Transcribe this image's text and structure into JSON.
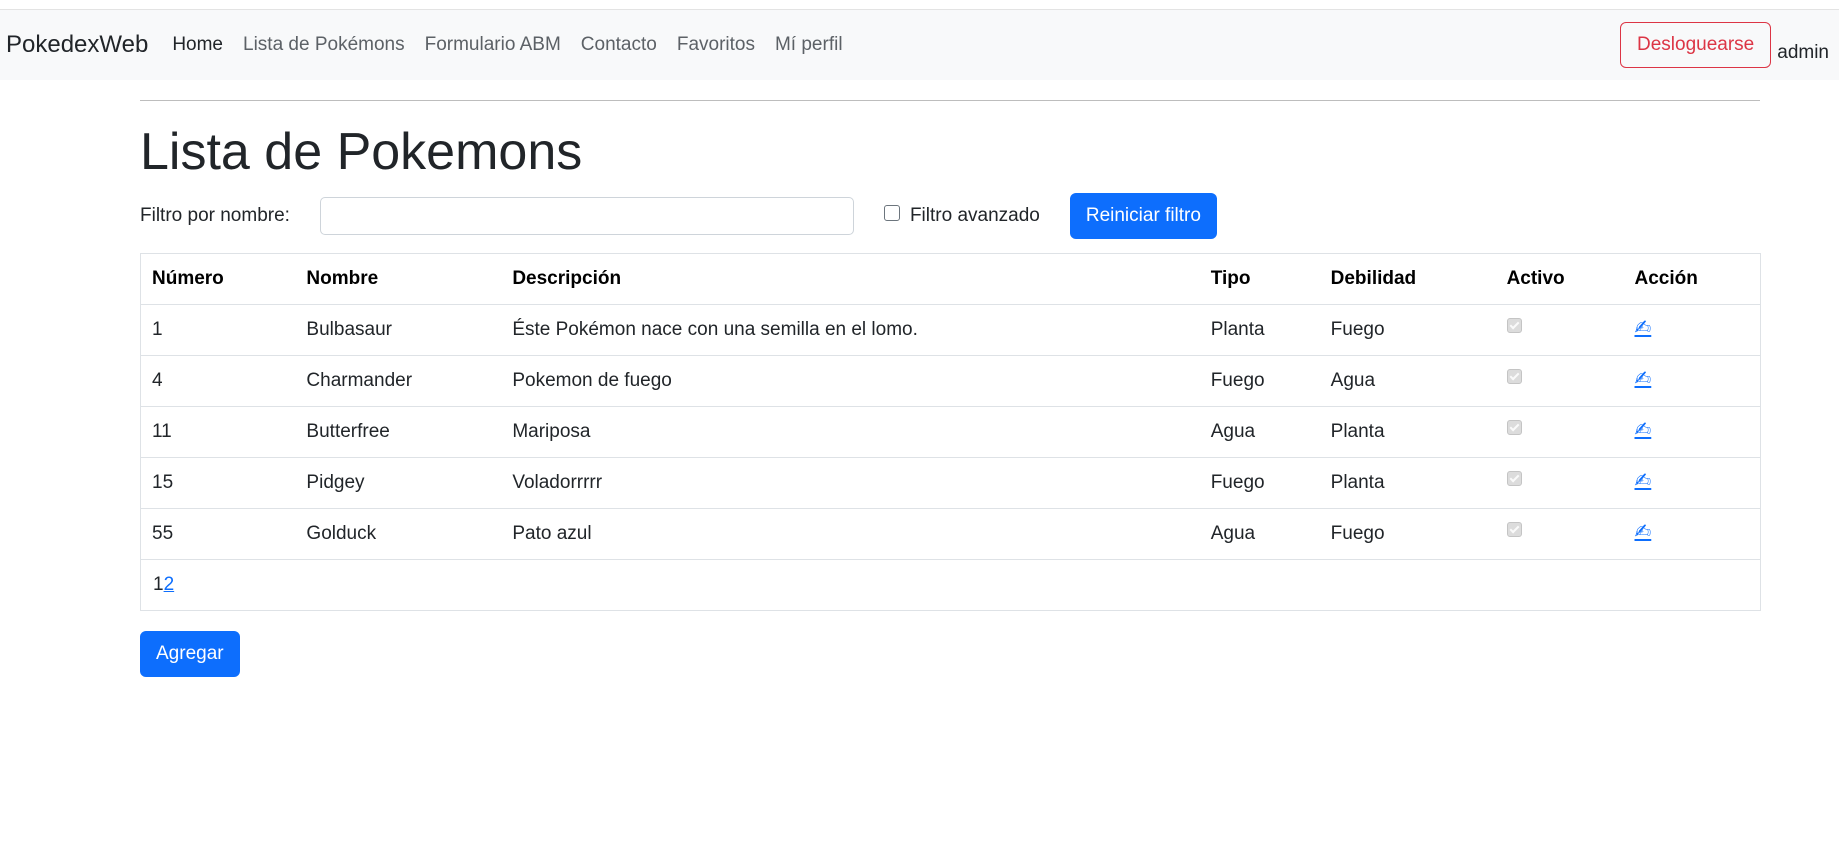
{
  "navbar": {
    "brand": "PokedexWeb",
    "links": [
      "Home",
      "Lista de Pokémons",
      "Formulario ABM",
      "Contacto",
      "Favoritos",
      "Mí perfil"
    ],
    "logout_label": "Desloguearse",
    "username": "admin"
  },
  "main": {
    "title": "Lista de Pokemons",
    "filter": {
      "label": "Filtro por nombre:",
      "value": "",
      "advanced_label": "Filtro avanzado",
      "advanced_checked": false,
      "reset_label": "Reiniciar filtro"
    },
    "table": {
      "headers": [
        "Número",
        "Nombre",
        "Descripción",
        "Tipo",
        "Debilidad",
        "Activo",
        "Acción"
      ],
      "rows": [
        {
          "numero": "1",
          "nombre": "Bulbasaur",
          "descripcion": "Éste Pokémon nace con una semilla en el lomo.",
          "tipo": "Planta",
          "debilidad": "Fuego",
          "activo": true,
          "accion_icon": "✍"
        },
        {
          "numero": "4",
          "nombre": "Charmander",
          "descripcion": "Pokemon de fuego",
          "tipo": "Fuego",
          "debilidad": "Agua",
          "activo": true,
          "accion_icon": "✍"
        },
        {
          "numero": "11",
          "nombre": "Butterfree",
          "descripcion": "Mariposa",
          "tipo": "Agua",
          "debilidad": "Planta",
          "activo": true,
          "accion_icon": "✍"
        },
        {
          "numero": "15",
          "nombre": "Pidgey",
          "descripcion": "Voladorrrrr",
          "tipo": "Fuego",
          "debilidad": "Planta",
          "activo": true,
          "accion_icon": "✍"
        },
        {
          "numero": "55",
          "nombre": "Golduck",
          "descripcion": "Pato azul",
          "tipo": "Agua",
          "debilidad": "Fuego",
          "activo": true,
          "accion_icon": "✍"
        }
      ]
    },
    "pagination": {
      "current": "1",
      "next": "2"
    },
    "add_label": "Agregar"
  },
  "colors": {
    "primary": "#0d6efd",
    "danger": "#dc3545",
    "navbar_bg": "#f8f9fa"
  }
}
